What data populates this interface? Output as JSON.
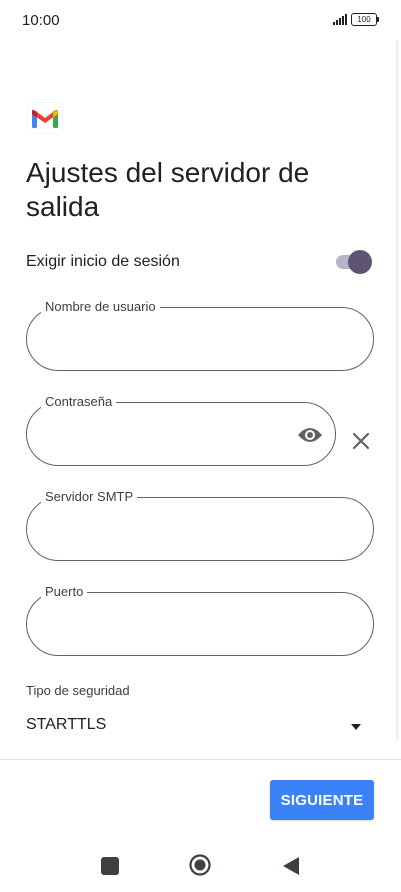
{
  "status_bar": {
    "time": "10:00",
    "battery": "100"
  },
  "app": {
    "logo_icon": "gmail-logo"
  },
  "page": {
    "title": "Ajustes del servidor de salida"
  },
  "require_signin": {
    "label": "Exigir inicio de sesión",
    "enabled": true
  },
  "fields": {
    "username": {
      "label": "Nombre de usuario",
      "value": ""
    },
    "password": {
      "label": "Contraseña",
      "value": ""
    },
    "smtp_server": {
      "label": "Servidor SMTP",
      "value": ""
    },
    "port": {
      "label": "Puerto",
      "value": ""
    }
  },
  "security": {
    "label": "Tipo de seguridad",
    "value": "STARTTLS"
  },
  "actions": {
    "next_label": "SIGUIENTE"
  },
  "colors": {
    "accent": "#3b82f6",
    "toggle_knob": "#5e5573",
    "toggle_track": "#b9b4c8",
    "outline": "#5f6368"
  }
}
